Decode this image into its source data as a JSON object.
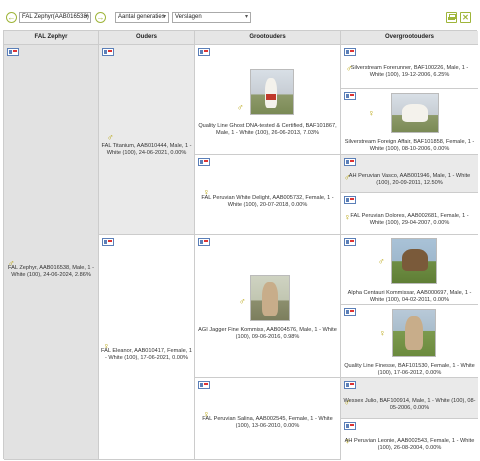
{
  "toolbar": {
    "animal_select": "FAL Zephyr(AAB016538)",
    "generations_select": "Aantal generaties",
    "report_select": "Verslagen",
    "back_symbol": "←",
    "forward_symbol": "→",
    "excel_symbol": "✕"
  },
  "columns": [
    "FAL Zephyr",
    "Ouders",
    "Grootouders",
    "Overgrootouders"
  ],
  "subject": {
    "text": "FAL Zephyr, AAB016538, Male, 1 - White (100), 24-06-2024, 2.86%",
    "sex": "male"
  },
  "parents": [
    {
      "text": "FAL Titanium, AAB010444, Male, 1 - White (100), 24-06-2021, 0.00%",
      "sex": "male"
    },
    {
      "text": "FAL Eleanor, AAB010417, Female, 1 - White (100), 17-06-2021, 0.00%",
      "sex": "female"
    }
  ],
  "grandparents": [
    {
      "text": "Quality Line Ghost DNA-tested & Certified, BAF101867, Male, 1 - White (100), 26-06-2013, 7.03%",
      "sex": "male",
      "photo": true
    },
    {
      "text": "FAL Peruvian White Delight, AAB005732, Female, 1 - White (100), 20-07-2018, 0.00%",
      "sex": "female",
      "photo": false
    },
    {
      "text": "AGI Jagger Fine Kommiss, AAB004576, Male, 1 - White (100), 09-06-2016, 0.98%",
      "sex": "male",
      "photo": true
    },
    {
      "text": "FAL Peruvian Salina, AAB002545, Female, 1 - White (100), 13-06-2010, 0.00%",
      "sex": "female",
      "photo": false
    }
  ],
  "great_grandparents": [
    {
      "text": "Silverstream Forerunner, BAF100226, Male, 1 - White (100), 19-12-2006, 6.25%",
      "sex": "male",
      "photo": false
    },
    {
      "text": "Silverstream Foreign Affair, BAF101858, Female, 1 - White (100), 08-10-2006, 0.00%",
      "sex": "female",
      "photo": true
    },
    {
      "text": "AH Peruvian Vasco, AAB001946, Male, 1 - White (100), 20-09-2011, 12.50%",
      "sex": "male",
      "photo": false
    },
    {
      "text": "FAL Peruvian Dolores, AAB002681, Female, 1 - White (100), 29-04-2007, 0.00%",
      "sex": "female",
      "photo": false
    },
    {
      "text": "Alpha Centauri Kommissar, AAB000697, Male, 1 - White (100), 04-02-2011, 0.00%",
      "sex": "male",
      "photo": true
    },
    {
      "text": "Quality Line Finesse, BAF101530, Female, 1 - White (100), 17-06-2012, 0.00%",
      "sex": "female",
      "photo": true
    },
    {
      "text": "Wessex Julio, BAF100914, Male, 1 - White (100), 08-05-2006, 0.00%",
      "sex": "male",
      "photo": false
    },
    {
      "text": "AH Peruvian Leonie, AAB002543, Female, 1 - White (100), 26-08-2004, 0.00%",
      "sex": "female",
      "photo": false
    }
  ],
  "icons": {
    "male": "♂",
    "female": "♀",
    "flag": "pedigree-flag-icon"
  },
  "colors": {
    "accent": "#9fb53a",
    "header_bg": "#e6e6e6",
    "subject_bg": "#e2e2e2",
    "sex_symbol": "#b5a000"
  }
}
